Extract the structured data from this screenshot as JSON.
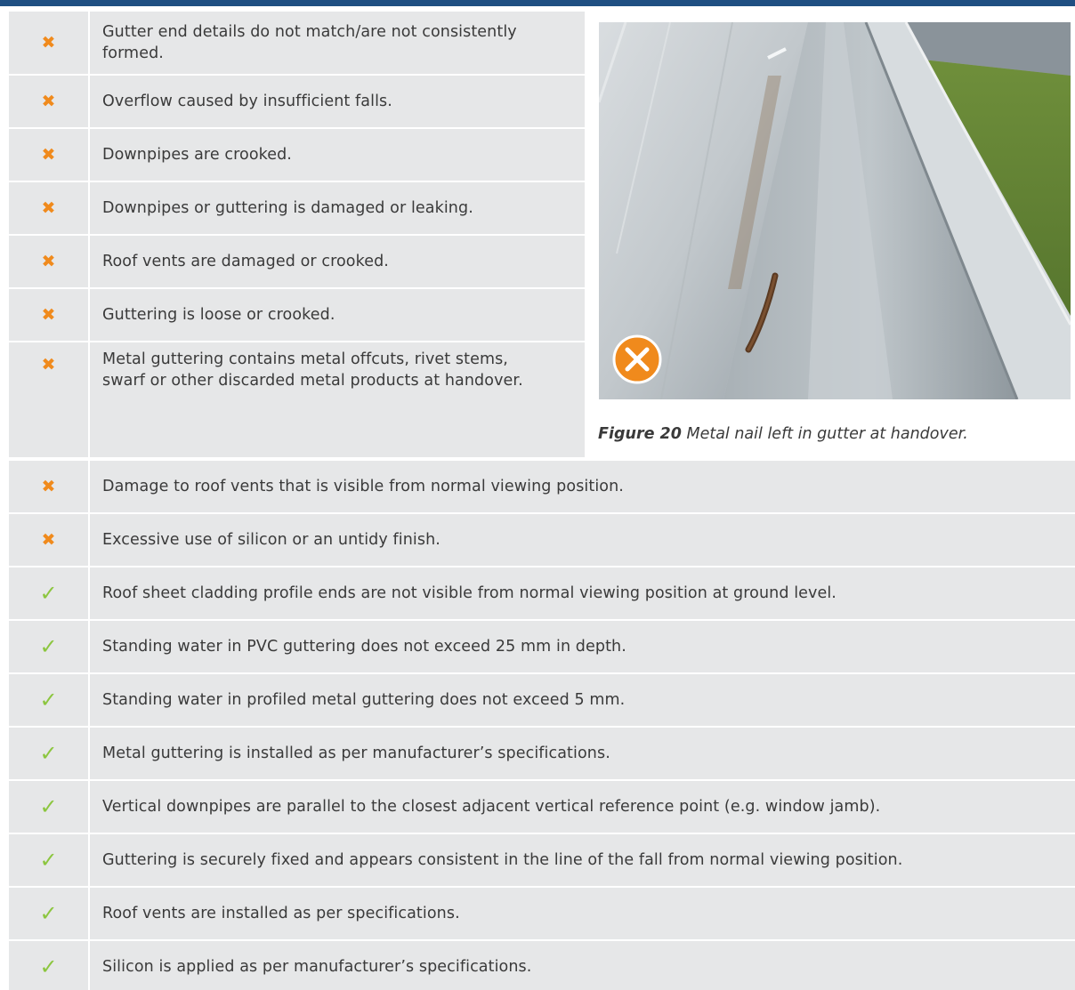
{
  "figure": {
    "label": "Figure 20",
    "text": "Metal nail left in gutter at handover."
  },
  "colors": {
    "header_bar": "#1f4f82",
    "row_bg": "#e6e7e8",
    "cross": "#f08a1c",
    "check": "#8cc63f"
  },
  "symbols": {
    "cross": "✖",
    "check": "✓"
  },
  "rows_top": [
    {
      "status": "fail",
      "text": "Gutter end details do not match/are not consistently formed."
    },
    {
      "status": "fail",
      "text": "Overflow caused by insufficient falls."
    },
    {
      "status": "fail",
      "text": "Downpipes are crooked."
    },
    {
      "status": "fail",
      "text": "Downpipes or guttering is damaged or leaking."
    },
    {
      "status": "fail",
      "text": "Roof vents are damaged or crooked."
    },
    {
      "status": "fail",
      "text": "Guttering is loose or crooked."
    },
    {
      "status": "fail",
      "text": "Metal guttering contains metal offcuts, rivet stems, swarf or other discarded metal products at handover."
    }
  ],
  "rows_bottom": [
    {
      "status": "fail",
      "text": "Damage to roof vents that is visible from normal viewing position."
    },
    {
      "status": "fail",
      "text": "Excessive use of silicon or an untidy finish."
    },
    {
      "status": "pass",
      "text": "Roof sheet cladding profile ends are not visible from normal viewing position at ground level."
    },
    {
      "status": "pass",
      "text": "Standing water in PVC guttering does not exceed 25 mm in depth."
    },
    {
      "status": "pass",
      "text": "Standing water in profiled metal guttering does not exceed 5 mm."
    },
    {
      "status": "pass",
      "text": "Metal guttering is installed as per manufacturer’s specifications."
    },
    {
      "status": "pass",
      "text": "Vertical downpipes are parallel to the closest adjacent vertical reference point (e.g. window jamb)."
    },
    {
      "status": "pass",
      "text": "Guttering is securely fixed and appears consistent in the line of the fall from normal viewing position."
    },
    {
      "status": "pass",
      "text": "Roof vents are installed as per specifications."
    },
    {
      "status": "pass",
      "text": "Silicon is applied as per manufacturer’s specifications."
    }
  ]
}
